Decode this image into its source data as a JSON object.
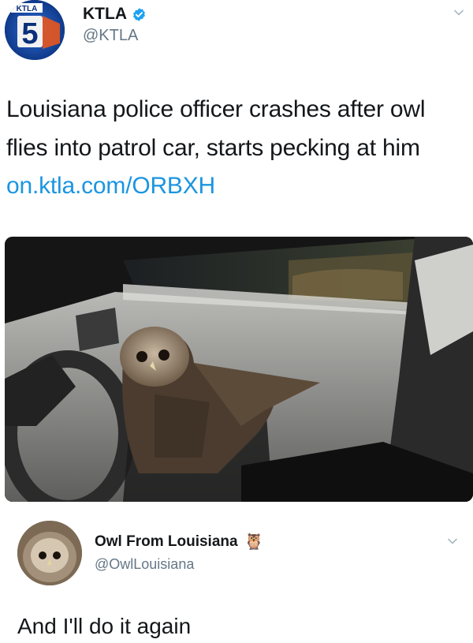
{
  "tweet": {
    "display_name": "KTLA",
    "handle": "@KTLA",
    "avatar_text": "KTLA",
    "avatar_number": "5",
    "text": "Louisiana police officer crashes after owl flies into patrol car, starts pecking at him ",
    "link": "on.ktla.com/ORBXH",
    "verified": true,
    "icons": [
      "verified-badge-icon",
      "chevron-down-icon"
    ],
    "colors": {
      "link": "#1b95e0",
      "verified": "#1da1f2",
      "handle": "#657786"
    }
  },
  "photo": {
    "subject": "owl-in-patrol-car-photo"
  },
  "reply": {
    "display_name": "Owl From Louisiana",
    "emoji": "🦉",
    "handle": "@OwlLouisiana",
    "text": "And I'll do it again",
    "icons": [
      "owl-emoji-icon",
      "chevron-down-icon"
    ]
  }
}
